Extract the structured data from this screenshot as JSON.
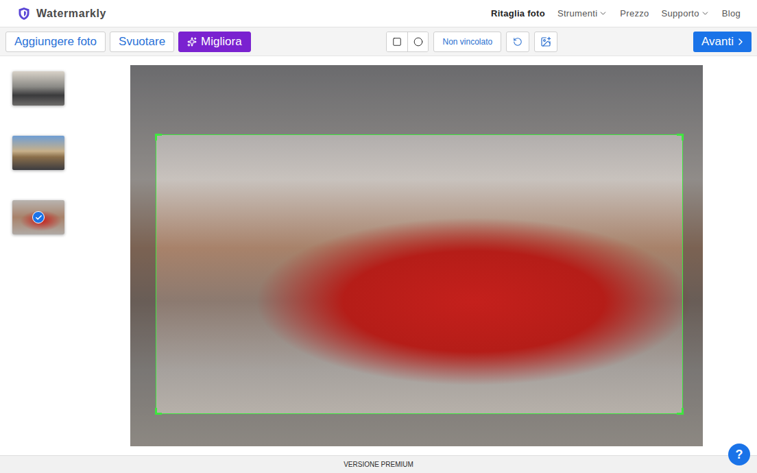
{
  "app": {
    "name": "Watermarkly"
  },
  "nav": [
    {
      "label": "Ritaglia foto",
      "selected": true,
      "dropdown": false
    },
    {
      "label": "Strumenti",
      "selected": false,
      "dropdown": true
    },
    {
      "label": "Prezzo",
      "selected": false,
      "dropdown": false
    },
    {
      "label": "Supporto",
      "selected": false,
      "dropdown": true
    },
    {
      "label": "Blog",
      "selected": false,
      "dropdown": false
    }
  ],
  "toolbar": {
    "buttons": [
      {
        "label": "Aggiungere foto",
        "kind": "outline"
      },
      {
        "label": "Svuotare",
        "kind": "outline"
      },
      {
        "label": "Migliora",
        "kind": "accent"
      }
    ],
    "aspect": "Non vincolato",
    "next": "Avanti"
  },
  "thumbnails": [
    {
      "selected": false
    },
    {
      "selected": false
    },
    {
      "selected": true
    }
  ],
  "footer": {
    "label": "VERSIONE PREMIUM"
  },
  "help": {
    "label": "?"
  }
}
